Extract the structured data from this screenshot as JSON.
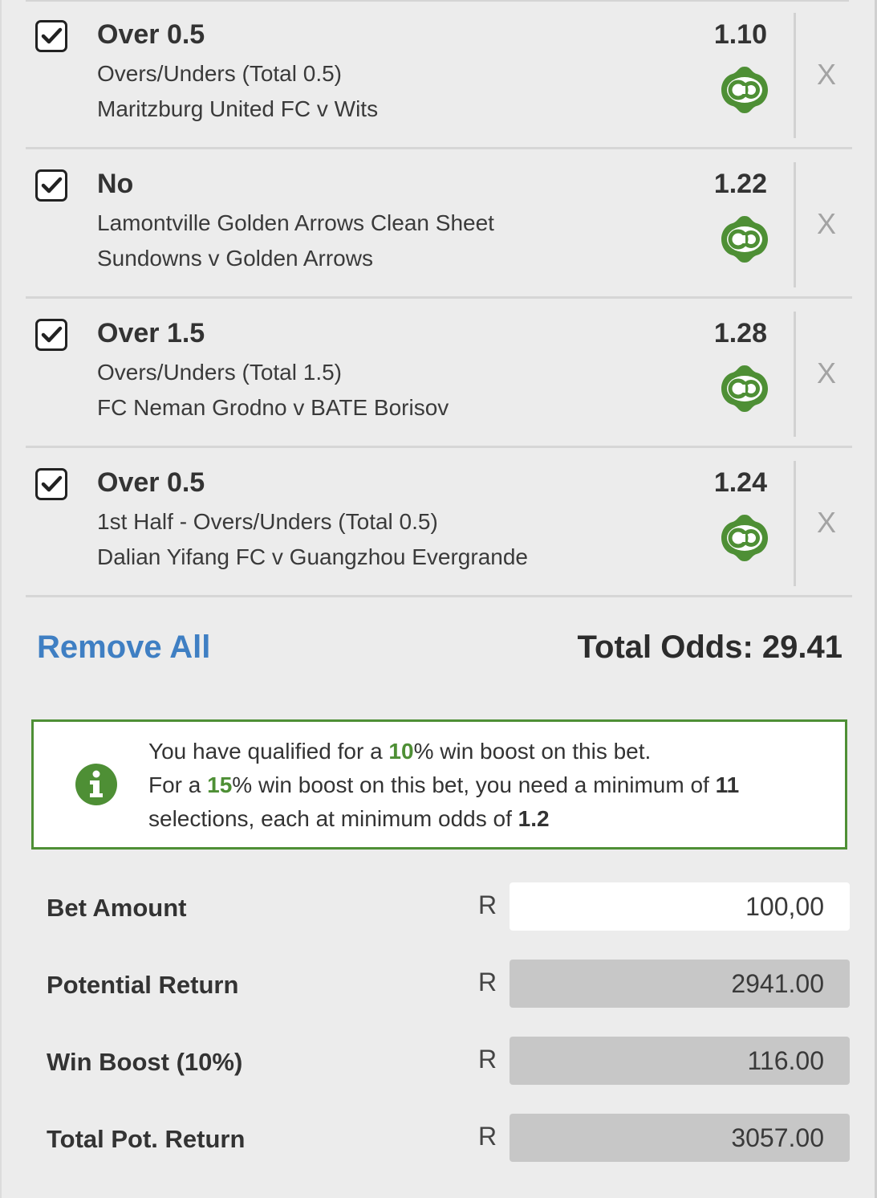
{
  "selections": [
    {
      "name": "Over 0.5",
      "market": "Overs/Unders (Total 0.5)",
      "match": "Maritzburg United FC v Wits",
      "odds": "1.10",
      "remove_label": "X",
      "checked": true
    },
    {
      "name": "No",
      "market": "Lamontville Golden Arrows Clean Sheet",
      "match": "Sundowns v Golden Arrows",
      "odds": "1.22",
      "remove_label": "X",
      "checked": true
    },
    {
      "name": "Over 1.5",
      "market": "Overs/Unders (Total 1.5)",
      "match": "FC Neman Grodno v BATE Borisov",
      "odds": "1.28",
      "remove_label": "X",
      "checked": true
    },
    {
      "name": "Over 0.5",
      "market": "1st Half - Overs/Unders (Total 0.5)",
      "match": "Dalian Yifang FC v Guangzhou Evergrande",
      "odds": "1.24",
      "remove_label": "X",
      "checked": true
    }
  ],
  "actions": {
    "remove_all": "Remove All"
  },
  "totals": {
    "total_odds": "Total Odds: 29.41"
  },
  "boost_notice": {
    "line1_pre": "You have qualified for a ",
    "line1_pct": "10",
    "line1_post": "% win boost on this bet.",
    "line2_pre": "For a ",
    "line2_pct": "15",
    "line2_mid": "% win boost on this bet, you need a minimum of ",
    "line2_count": "11",
    "line3_pre": "selections, each at minimum odds of ",
    "line3_odds": "1.2"
  },
  "bet": {
    "currency": "R",
    "bet_amount_label": "Bet Amount",
    "bet_amount_value": "100,00",
    "potential_return_label": "Potential Return",
    "potential_return_value": "2941.00",
    "win_boost_label": "Win Boost (10%)",
    "win_boost_value": "116.00",
    "total_return_label": "Total Pot. Return",
    "total_return_value": "3057.00"
  },
  "icons": {
    "checkbox": "checkmark-icon",
    "boost": "co-boost-icon",
    "info": "info-icon"
  },
  "colors": {
    "accent_green": "#4e8f35",
    "link_blue": "#3f7fc3",
    "background": "#ececec"
  }
}
